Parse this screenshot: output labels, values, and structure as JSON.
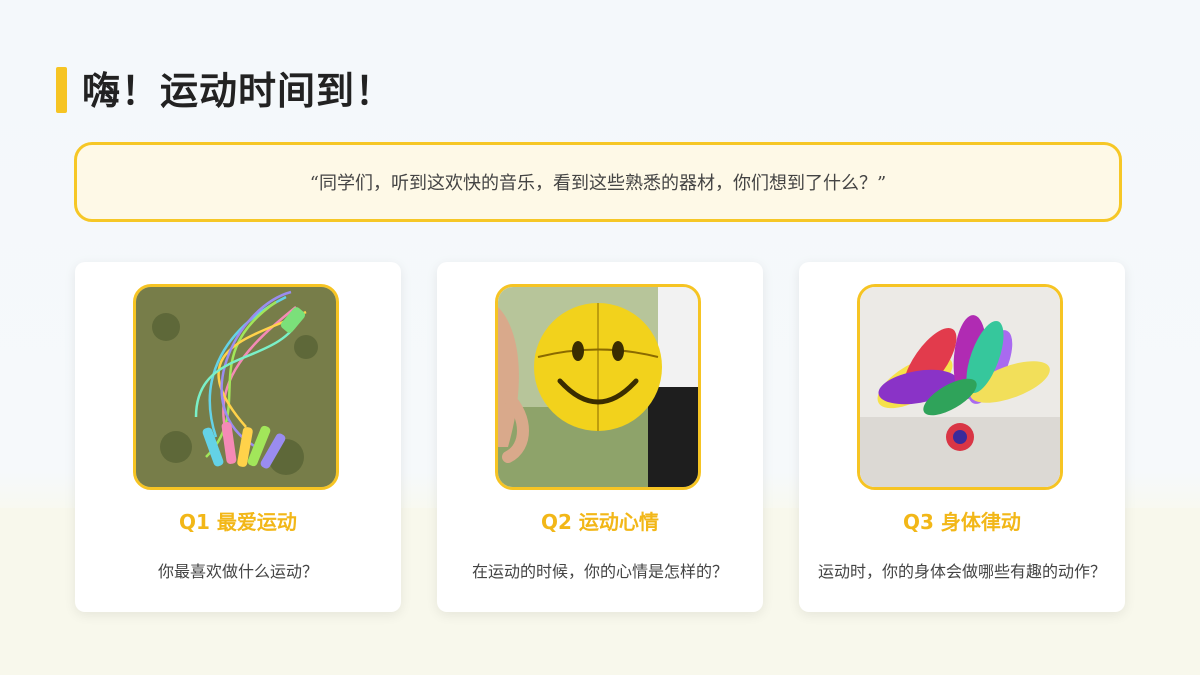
{
  "heading": {
    "title": "嗨！运动时间到！"
  },
  "prompt": {
    "quote": "“同学们，听到这欢快的音乐，看到这些熟悉的器材，你们想到了什么？”"
  },
  "cards": [
    {
      "title": "Q1 最爱运动",
      "question": "你最喜欢做什么运动？",
      "image": "jump-ropes-photo"
    },
    {
      "title": "Q2 运动心情",
      "question": "在运动的时候，你的心情是怎样的？",
      "image": "smiley-basketball-photo"
    },
    {
      "title": "Q3 身体律动",
      "question": "运动时，你的身体会做哪些有趣的动作？",
      "image": "feather-shuttlecock-photo"
    }
  ],
  "colors": {
    "accent": "#f6c423",
    "quote_bg": "#fef9e7",
    "card_bg": "#ffffff",
    "text": "#222222"
  }
}
